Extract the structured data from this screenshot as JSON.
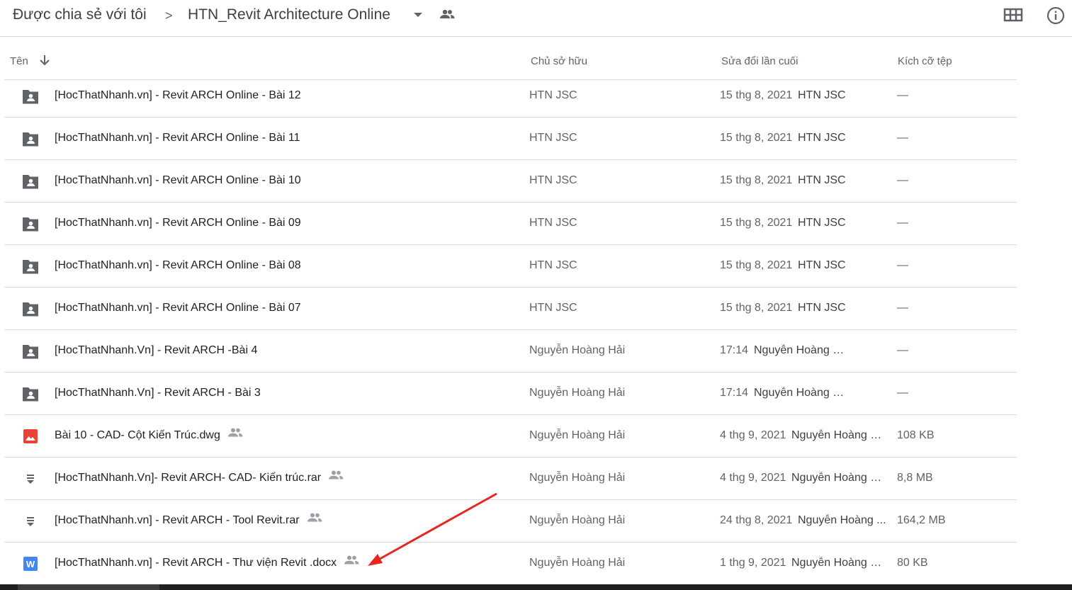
{
  "breadcrumb": {
    "root": "Được chia sẻ với tôi",
    "separator": ">",
    "current": "HTN_Revit Architecture Online"
  },
  "toolbar": {
    "grid_icon": "grid-view-icon",
    "info_icon": "info-icon"
  },
  "columns": {
    "name": "Tên",
    "owner": "Chủ sở hữu",
    "modified": "Sửa đổi lần cuối",
    "size": "Kích cỡ tệp"
  },
  "files": [
    {
      "icon": "shared-folder-icon",
      "name": "[HocThatNhanh.vn] - Revit ARCH Online - Bài 12",
      "shared": false,
      "owner": "HTN JSC",
      "date": "15 thg 8, 2021",
      "modifier": "HTN JSC",
      "size": "—"
    },
    {
      "icon": "shared-folder-icon",
      "name": "[HocThatNhanh.vn] - Revit ARCH Online - Bài 11",
      "shared": false,
      "owner": "HTN JSC",
      "date": "15 thg 8, 2021",
      "modifier": "HTN JSC",
      "size": "—"
    },
    {
      "icon": "shared-folder-icon",
      "name": "[HocThatNhanh.vn] - Revit ARCH Online - Bài 10",
      "shared": false,
      "owner": "HTN JSC",
      "date": "15 thg 8, 2021",
      "modifier": "HTN JSC",
      "size": "—"
    },
    {
      "icon": "shared-folder-icon",
      "name": "[HocThatNhanh.vn] - Revit ARCH Online - Bài 09",
      "shared": false,
      "owner": "HTN JSC",
      "date": "15 thg 8, 2021",
      "modifier": "HTN JSC",
      "size": "—"
    },
    {
      "icon": "shared-folder-icon",
      "name": "[HocThatNhanh.vn] - Revit ARCH Online - Bài 08",
      "shared": false,
      "owner": "HTN JSC",
      "date": "15 thg 8, 2021",
      "modifier": "HTN JSC",
      "size": "—"
    },
    {
      "icon": "shared-folder-icon",
      "name": "[HocThatNhanh.vn] - Revit ARCH Online - Bài 07",
      "shared": false,
      "owner": "HTN JSC",
      "date": "15 thg 8, 2021",
      "modifier": "HTN JSC",
      "size": "—"
    },
    {
      "icon": "shared-folder-icon",
      "name": "[HocThatNhanh.Vn] - Revit ARCH -Bài 4",
      "shared": false,
      "owner": "Nguyễn Hoàng Hải",
      "date": "17:14",
      "modifier": "Nguyễn Hoàng Hải",
      "size": "—"
    },
    {
      "icon": "shared-folder-icon",
      "name": "[HocThatNhanh.Vn] - Revit ARCH - Bài 3",
      "shared": false,
      "owner": "Nguyễn Hoàng Hải",
      "date": "17:14",
      "modifier": "Nguyễn Hoàng Hải",
      "size": "—"
    },
    {
      "icon": "image-file-icon",
      "name": "Bài 10 - CAD- Cột Kiến Trúc.dwg",
      "shared": true,
      "owner": "Nguyễn Hoàng Hải",
      "date": "4 thg 9, 2021",
      "modifier": "Nguyễn Hoàng Hải",
      "size": "108 KB"
    },
    {
      "icon": "archive-file-icon",
      "name": "[HocThatNhanh.Vn]- Revit ARCH- CAD- Kiến trúc.rar",
      "shared": true,
      "owner": "Nguyễn Hoàng Hải",
      "date": "4 thg 9, 2021",
      "modifier": "Nguyễn Hoàng Hải",
      "size": "8,8 MB"
    },
    {
      "icon": "archive-file-icon",
      "name": "[HocThatNhanh.vn] - Revit ARCH - Tool Revit.rar",
      "shared": true,
      "owner": "Nguyễn Hoàng Hải",
      "date": "24 thg 8, 2021",
      "modifier": "Nguyễn Hoàng ...",
      "size": "164,2 MB"
    },
    {
      "icon": "word-doc-icon",
      "name": "[HocThatNhanh.vn] - Revit ARCH - Thư viện Revit .docx",
      "shared": true,
      "owner": "Nguyễn Hoàng Hải",
      "date": "1 thg 9, 2021",
      "modifier": "Nguyễn Hoàng Hải",
      "size": "80 KB"
    }
  ],
  "colors": {
    "folder": "#5f6368",
    "image": "#ea4335",
    "word": "#4285f4",
    "annotation_arrow": "#e8261c"
  },
  "annotation": {
    "icon": "red-arrow-pointer-icon"
  }
}
